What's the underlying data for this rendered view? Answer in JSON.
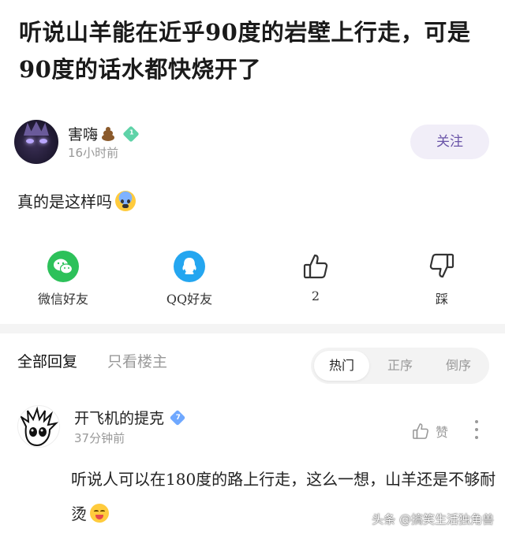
{
  "post": {
    "title": "听说山羊能在近乎90度的岩壁上行走，可是90度的话水都快烧开了",
    "author": {
      "name": "害嗨",
      "name_emoji": "poop-emoji",
      "level": "1",
      "time": "16小时前",
      "follow_label": "关注"
    },
    "body": "真的是这样吗",
    "body_emoji": "fearful-face-emoji"
  },
  "share": {
    "items": [
      {
        "label": "微信好友",
        "icon": "wechat-icon"
      },
      {
        "label": "QQ好友",
        "icon": "qq-icon"
      },
      {
        "label": "2",
        "icon": "thumbs-up-icon"
      },
      {
        "label": "踩",
        "icon": "thumbs-down-icon"
      }
    ]
  },
  "replies": {
    "tabs": [
      "全部回复",
      "只看楼主"
    ],
    "sort_options": [
      "热门",
      "正序",
      "倒序"
    ],
    "active_sort": "热门"
  },
  "comments": [
    {
      "name": "开飞机的提克",
      "level": "7",
      "time": "37分钟前",
      "like_label": "赞",
      "text": "听说人可以在180度的路上行走，这么一想，山羊还是不够耐烫",
      "emoji": "yum-face-emoji"
    }
  ],
  "watermark": "头条 @搞笑生活独角兽",
  "colors": {
    "accent": "#6a54a8",
    "follow_bg": "#f1eef8",
    "wechat": "#2dc15a",
    "qq": "#24a6f0",
    "muted": "#999999"
  }
}
